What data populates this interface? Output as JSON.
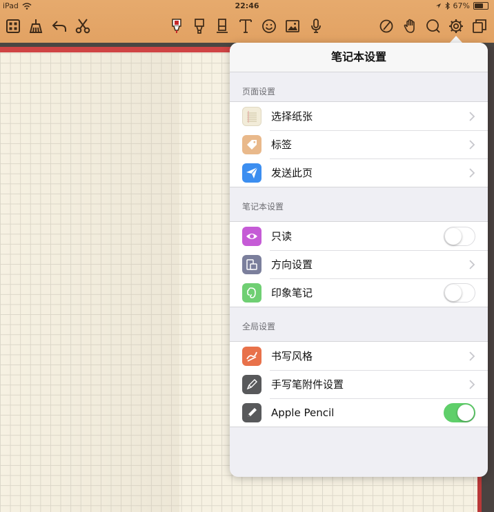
{
  "status_bar": {
    "device": "iPad",
    "time": "22:46",
    "battery": "67%"
  },
  "toolbar": {
    "left_icons": [
      "grid-icon",
      "broom-icon",
      "undo-icon",
      "scissors-icon"
    ],
    "center_icons": [
      "pen-icon",
      "highlighter-icon",
      "eraser-icon",
      "text-icon",
      "emoji-icon",
      "image-icon",
      "microphone-icon"
    ],
    "right_icons": [
      "lasso-icon",
      "hand-icon",
      "zoom-icon",
      "settings-icon",
      "pages-icon"
    ]
  },
  "popover": {
    "title": "笔记本设置",
    "sections": [
      {
        "title": "页面设置",
        "items": [
          {
            "label": "选择纸张",
            "icon": "paper-icon",
            "icon_color": "#f2ecd9",
            "accessory": "chevron"
          },
          {
            "label": "标签",
            "icon": "tag-icon",
            "icon_color": "#e9b98b",
            "accessory": "chevron"
          },
          {
            "label": "发送此页",
            "icon": "send-icon",
            "icon_color": "#3c8ef0",
            "accessory": "chevron"
          }
        ]
      },
      {
        "title": "笔记本设置",
        "items": [
          {
            "label": "只读",
            "icon": "eye-icon",
            "icon_color": "#c55bd6",
            "accessory": "toggle",
            "on": false
          },
          {
            "label": "方向设置",
            "icon": "orientation-icon",
            "icon_color": "#7b7f9c",
            "accessory": "chevron"
          },
          {
            "label": "印象笔记",
            "icon": "evernote-icon",
            "icon_color": "#6fcf73",
            "accessory": "toggle",
            "on": false
          }
        ]
      },
      {
        "title": "全局设置",
        "items": [
          {
            "label": "书写风格",
            "icon": "handwriting-icon",
            "icon_color": "#e8714a",
            "accessory": "chevron"
          },
          {
            "label": "手写笔附件设置",
            "icon": "stylus-icon",
            "icon_color": "#58595b",
            "accessory": "chevron"
          },
          {
            "label": "Apple Pencil",
            "icon": "pencil-icon",
            "icon_color": "#58595b",
            "accessory": "toggle",
            "on": true
          }
        ]
      }
    ]
  },
  "colors": {
    "toolbar": "#e4a566",
    "accent_red": "#cf4444",
    "toggle_on": "#5fcf6a"
  }
}
